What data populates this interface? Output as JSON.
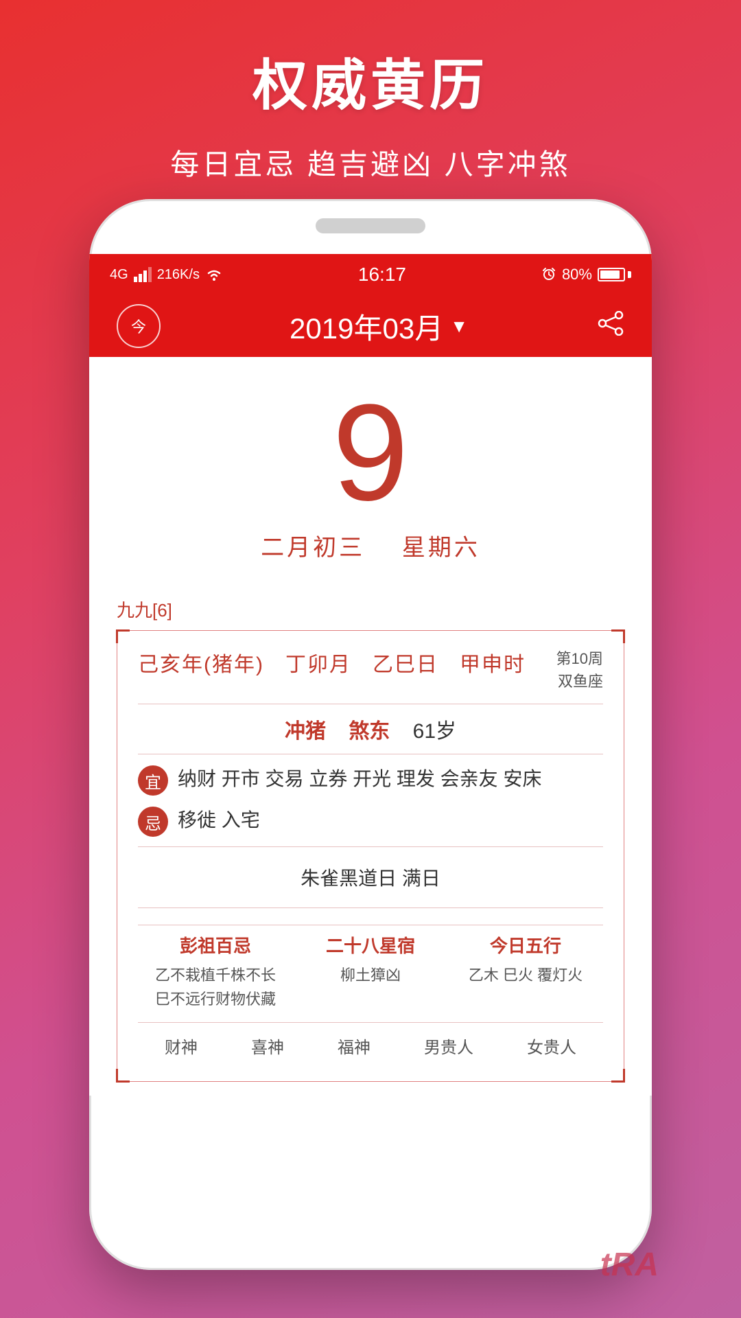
{
  "background": {
    "gradient_start": "#e83030",
    "gradient_end": "#c060a0"
  },
  "header": {
    "title": "权威黄历",
    "subtitle": "每日宜忌 趋吉避凶 八字冲煞"
  },
  "status_bar": {
    "signal": "4G",
    "speed": "216K/s",
    "wifi": "WiFi",
    "time": "16:17",
    "alarm": "🔔",
    "battery_percent": "80%"
  },
  "nav": {
    "today_label": "今",
    "month_title": "2019年03月",
    "dropdown_arrow": "▼"
  },
  "date": {
    "day_number": "9",
    "lunar": "二月初三",
    "weekday": "星期六"
  },
  "nine_nine": {
    "label": "九九[6]"
  },
  "ganzhi": {
    "year": "己亥年(猪年)",
    "month": "丁卯月",
    "day": "乙巳日",
    "time": "甲申时",
    "week_num": "第10周",
    "zodiac": "双鱼座"
  },
  "chong": {
    "label1": "冲猪",
    "label2": "煞东",
    "age": "61岁"
  },
  "yi": {
    "badge": "宜",
    "items": "纳财 开市 交易 立券 开光 理发 会亲友 安床"
  },
  "ji": {
    "badge": "忌",
    "items": "移徙 入宅"
  },
  "black_day": {
    "text": "朱雀黑道日  满日"
  },
  "bottom_grid": [
    {
      "title": "彭祖百忌",
      "lines": [
        "乙不栽植千株不长",
        "巳不远行财物伏藏"
      ]
    },
    {
      "title": "二十八星宿",
      "lines": [
        "柳土獐凶"
      ]
    },
    {
      "title": "今日五行",
      "lines": [
        "乙木 巳火 覆灯火"
      ]
    }
  ],
  "shen_row": {
    "items": [
      "财神",
      "喜神",
      "福神",
      "男贵人",
      "女贵人"
    ]
  },
  "watermark": {
    "text": "tRA"
  }
}
